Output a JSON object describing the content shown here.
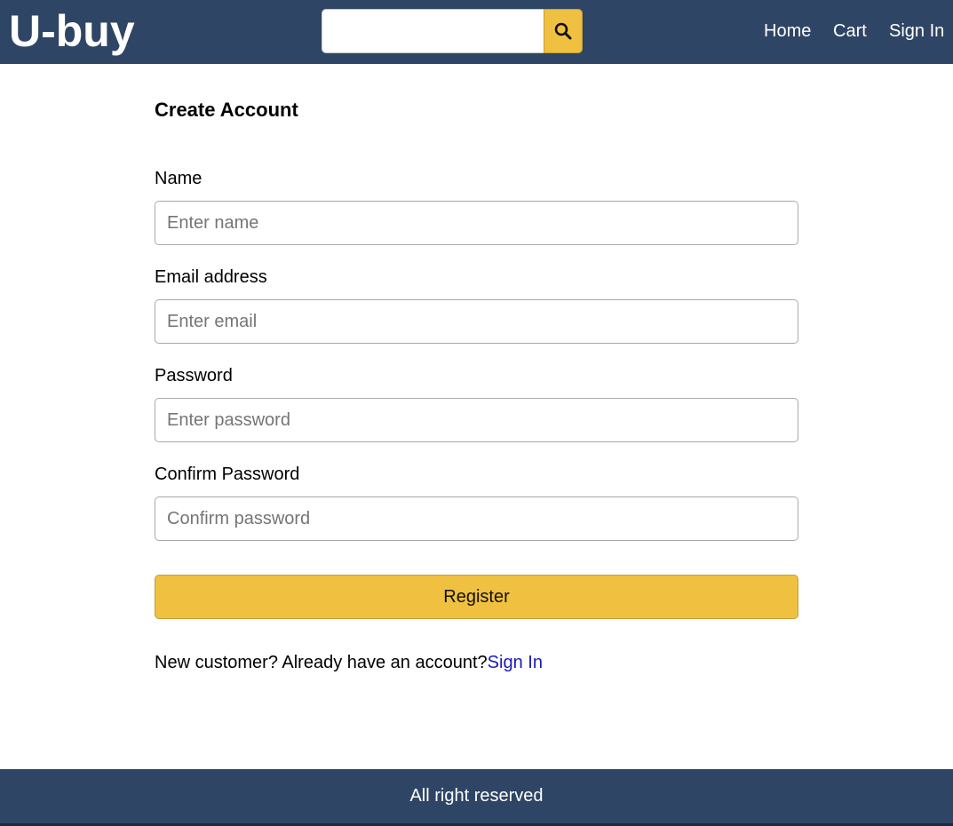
{
  "header": {
    "logo": "U-buy",
    "search": {
      "value": "",
      "placeholder": "",
      "icon": "search-icon"
    },
    "nav": {
      "home": "Home",
      "cart": "Cart",
      "sign_in": "Sign In"
    }
  },
  "form": {
    "title": "Create Account",
    "fields": [
      {
        "label": "Name",
        "placeholder": "Enter name",
        "value": ""
      },
      {
        "label": "Email address",
        "placeholder": "Enter email",
        "value": ""
      },
      {
        "label": "Password",
        "placeholder": "Enter password",
        "value": ""
      },
      {
        "label": "Confirm Password",
        "placeholder": "Confirm password",
        "value": ""
      }
    ],
    "register_label": "Register",
    "signin_prompt": "New customer? Already have an account?",
    "signin_link": "Sign In"
  },
  "footer": {
    "text": "All right reserved"
  },
  "colors": {
    "header_bg": "#2f4565",
    "accent": "#f0c040",
    "link": "#1a1ab8"
  }
}
